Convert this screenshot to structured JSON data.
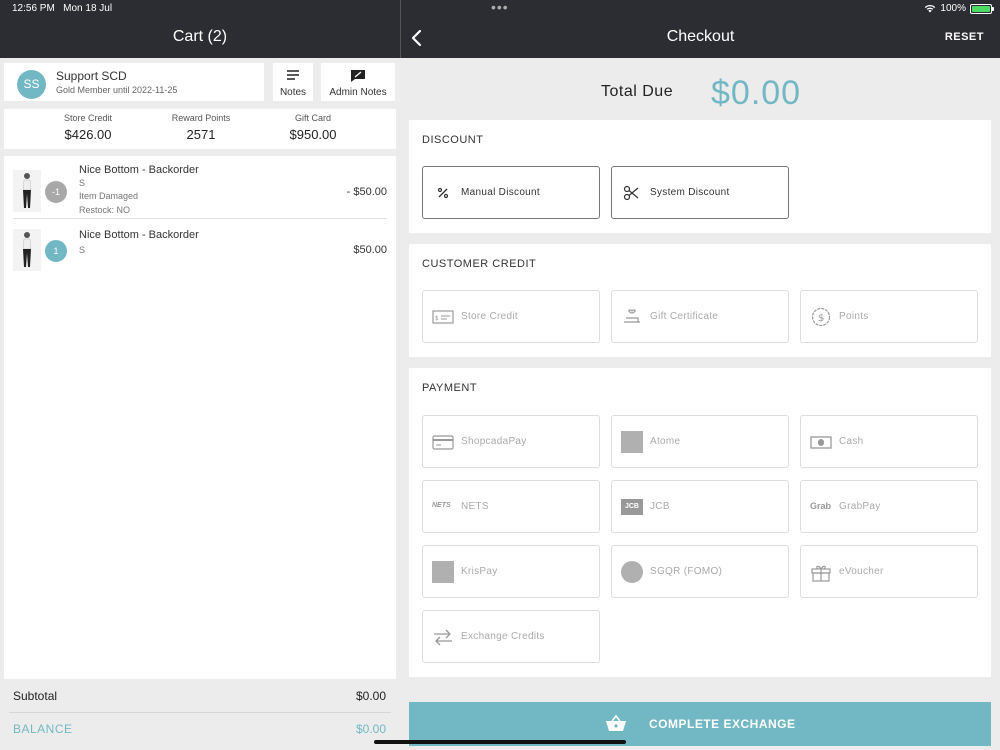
{
  "status": {
    "time": "12:56 PM",
    "date": "Mon 18 Jul",
    "battery": "100%",
    "battery_level": 1.0
  },
  "cart": {
    "title": "Cart (2)",
    "customer": {
      "initials": "SS",
      "name": "Support SCD",
      "membership": "Gold Member until 2022-11-25"
    },
    "notes_label": "Notes",
    "admin_notes_label": "Admin Notes",
    "stats": [
      {
        "label": "Store Credit",
        "value": "$426.00"
      },
      {
        "label": "Reward Points",
        "value": "2571"
      },
      {
        "label": "Gift Card",
        "value": "$950.00"
      }
    ],
    "items": [
      {
        "name": "Nice Bottom - Backorder",
        "variant": "S",
        "note1": "Item Damaged",
        "note2": "Restock: NO",
        "qty": "-1",
        "price": "- $50.00"
      },
      {
        "name": "Nice Bottom - Backorder",
        "variant": "S",
        "qty": "1",
        "price": "$50.00"
      }
    ],
    "subtotal_label": "Subtotal",
    "subtotal_value": "$0.00",
    "balance_label": "BALANCE",
    "balance_value": "$0.00"
  },
  "checkout": {
    "title": "Checkout",
    "reset_label": "RESET",
    "total_label": "Total Due",
    "total_value": "$0.00",
    "discount": {
      "title": "DISCOUNT",
      "options": [
        "Manual Discount",
        "System Discount"
      ]
    },
    "credit": {
      "title": "CUSTOMER CREDIT",
      "options": [
        "Store Credit",
        "Gift Certificate",
        "Points"
      ]
    },
    "payment": {
      "title": "PAYMENT",
      "options": [
        "ShopcadaPay",
        "Atome",
        "Cash",
        "NETS",
        "JCB",
        "GrabPay",
        "KrisPay",
        "SGQR (FOMO)",
        "eVoucher",
        "Exchange Credits"
      ],
      "nets_logo": "NETS",
      "jcb_logo": "JCB",
      "grab_logo": "Grab"
    },
    "complete_label": "COMPLETE EXCHANGE"
  },
  "colors": {
    "accent": "#72b8c4",
    "header": "#2c2d33",
    "badge_grey": "#a8a8a8"
  }
}
